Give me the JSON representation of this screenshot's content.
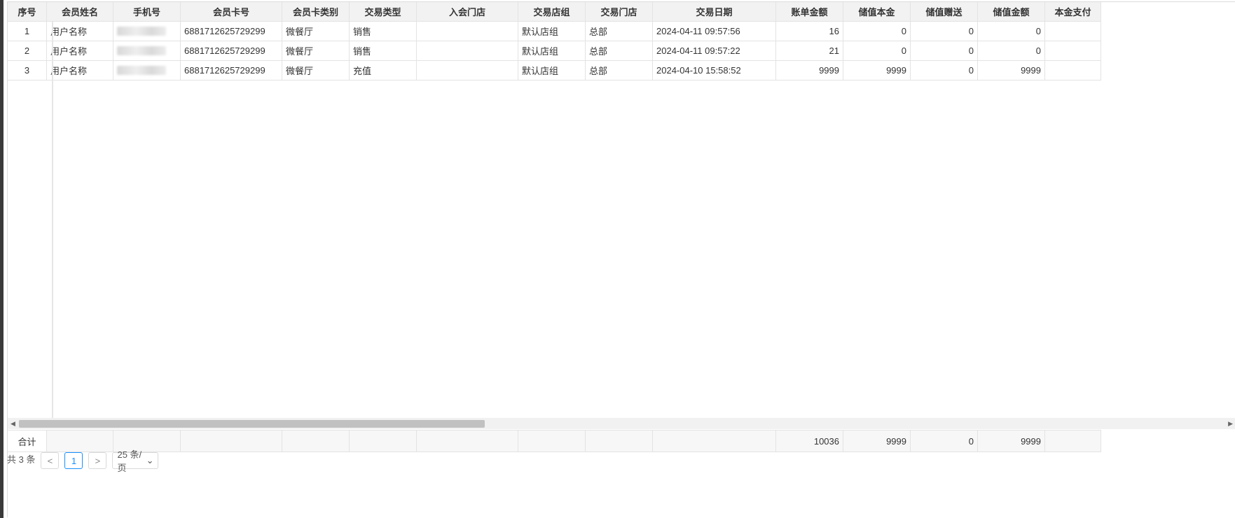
{
  "table": {
    "headers": [
      "序号",
      "会员姓名",
      "手机号",
      "会员卡号",
      "会员卡类别",
      "交易类型",
      "入会门店",
      "交易店组",
      "交易门店",
      "交易日期",
      "账单金额",
      "储值本金",
      "储值赠送",
      "储值金额",
      "本金支付"
    ],
    "rows": [
      [
        "1",
        "用户名称",
        "",
        "6881712625729299",
        "微餐厅",
        "销售",
        "",
        "默认店组",
        "总部",
        "2024-04-11 09:57:56",
        "16",
        "0",
        "0",
        "0",
        ""
      ],
      [
        "2",
        "用户名称",
        "",
        "6881712625729299",
        "微餐厅",
        "销售",
        "",
        "默认店组",
        "总部",
        "2024-04-11 09:57:22",
        "21",
        "0",
        "0",
        "0",
        ""
      ],
      [
        "3",
        "用户名称",
        "",
        "6881712625729299",
        "微餐厅",
        "充值",
        "",
        "默认店组",
        "总部",
        "2024-04-10 15:58:52",
        "9999",
        "9999",
        "0",
        "9999",
        ""
      ]
    ],
    "footer": {
      "label": "合计",
      "bill_total": "10036",
      "stored_principal_total": "9999",
      "stored_bonus_total": "0",
      "stored_amount_total": "9999"
    }
  },
  "pager": {
    "total_text": "共 3 条",
    "prev": "<",
    "page": "1",
    "next": ">",
    "page_size": "25 条/页"
  }
}
